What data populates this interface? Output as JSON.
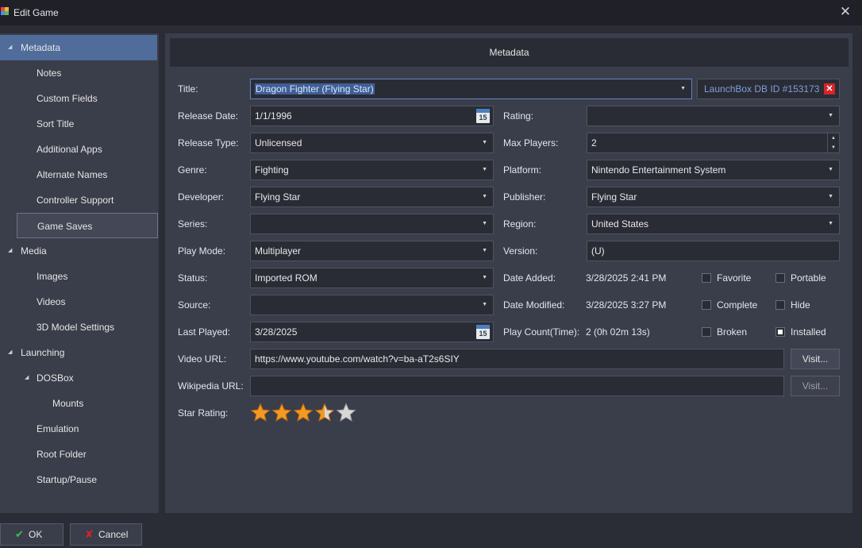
{
  "window": {
    "title": "Edit Game",
    "close_icon": "close-icon",
    "app_icon": "launchbox-icon"
  },
  "sidebar": {
    "items": [
      {
        "key": "metadata",
        "label": "Metadata",
        "expander": true,
        "selected": true
      },
      {
        "key": "notes",
        "label": "Notes"
      },
      {
        "key": "custom-fields",
        "label": "Custom Fields"
      },
      {
        "key": "sort-title",
        "label": "Sort Title"
      },
      {
        "key": "additional-apps",
        "label": "Additional Apps"
      },
      {
        "key": "alternate-names",
        "label": "Alternate Names"
      },
      {
        "key": "controller-support",
        "label": "Controller Support"
      },
      {
        "key": "game-saves",
        "label": "Game Saves",
        "hovered": true
      },
      {
        "key": "media",
        "label": "Media",
        "expander": true
      },
      {
        "key": "images",
        "label": "Images"
      },
      {
        "key": "videos",
        "label": "Videos"
      },
      {
        "key": "3d-model-settings",
        "label": "3D Model Settings"
      },
      {
        "key": "launching",
        "label": "Launching",
        "expander": true
      },
      {
        "key": "dosbox",
        "label": "DOSBox",
        "expander": true
      },
      {
        "key": "mounts",
        "label": "Mounts"
      },
      {
        "key": "emulation",
        "label": "Emulation"
      },
      {
        "key": "root-folder",
        "label": "Root Folder"
      },
      {
        "key": "startup-pause",
        "label": "Startup/Pause"
      }
    ],
    "expander_glyph": "◢"
  },
  "main": {
    "header": "Metadata",
    "title": {
      "label": "Title:",
      "value": "Dragon Fighter (Flying Star)"
    },
    "launchbox_db": {
      "text": "LaunchBox DB ID #153173",
      "remove_icon": "remove-x-icon"
    },
    "release_date": {
      "label": "Release Date:",
      "value": "1/1/1996",
      "calendar_day": "15"
    },
    "rating": {
      "label": "Rating:",
      "value": ""
    },
    "release_type": {
      "label": "Release Type:",
      "value": "Unlicensed"
    },
    "max_players": {
      "label": "Max Players:",
      "value": "2"
    },
    "genre": {
      "label": "Genre:",
      "value": "Fighting"
    },
    "platform": {
      "label": "Platform:",
      "value": "Nintendo Entertainment System"
    },
    "developer": {
      "label": "Developer:",
      "value": "Flying Star"
    },
    "publisher": {
      "label": "Publisher:",
      "value": "Flying Star"
    },
    "series": {
      "label": "Series:",
      "value": ""
    },
    "region": {
      "label": "Region:",
      "value": "United States"
    },
    "play_mode": {
      "label": "Play Mode:",
      "value": "Multiplayer"
    },
    "version": {
      "label": "Version:",
      "value": "(U)"
    },
    "status": {
      "label": "Status:",
      "value": "Imported ROM"
    },
    "date_added": {
      "label": "Date Added:",
      "value": "3/28/2025 2:41 PM"
    },
    "source": {
      "label": "Source:",
      "value": ""
    },
    "date_modified": {
      "label": "Date Modified:",
      "value": "3/28/2025 3:27 PM"
    },
    "last_played": {
      "label": "Last Played:",
      "value": "3/28/2025",
      "calendar_day": "15"
    },
    "play_count": {
      "label": "Play Count(Time):",
      "value": "2 (0h 02m 13s)"
    },
    "checkboxes": {
      "favorite": {
        "label": "Favorite",
        "checked": false
      },
      "portable": {
        "label": "Portable",
        "checked": false
      },
      "complete": {
        "label": "Complete",
        "checked": false
      },
      "hide": {
        "label": "Hide",
        "checked": false
      },
      "broken": {
        "label": "Broken",
        "checked": false
      },
      "installed": {
        "label": "Installed",
        "checked": true
      }
    },
    "video_url": {
      "label": "Video URL:",
      "value": "https://www.youtube.com/watch?v=ba-aT2s6SIY",
      "button": "Visit..."
    },
    "wikipedia_url": {
      "label": "Wikipedia URL:",
      "value": "",
      "button": "Visit..."
    },
    "star_rating": {
      "label": "Star Rating:",
      "value": 3.5,
      "max": 5
    }
  },
  "footer": {
    "ok": {
      "label": "OK",
      "icon": "checkmark-icon"
    },
    "cancel": {
      "label": "Cancel",
      "icon": "cancel-x-icon"
    }
  },
  "colors": {
    "accent": "#4f6c9a",
    "star_fill": "#f29a23",
    "star_empty": "#d8d8d8",
    "link_text": "#7f9fd9",
    "remove_red": "#d4242a"
  }
}
